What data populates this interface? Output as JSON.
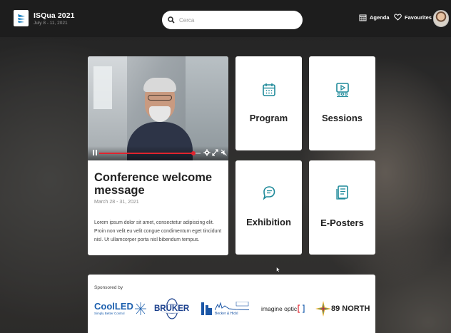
{
  "header": {
    "brand_title": "ISQua 2021",
    "brand_dates": "July 8 - 11, 2021",
    "search_placeholder": "Cerca",
    "agenda_label": "Agenda",
    "favourites_label": "Favourites"
  },
  "video_card": {
    "title": "Conference welcome message",
    "date": "March 28 - 31, 2021",
    "description": "Lorem ipsum dolor sit amet, consectetur adipiscing elit. Proin non velit eu velit congue condimentum eget tincidunt nisl. Ut ullamcorper porta nisl bibendum tempus.",
    "progress": 0.93
  },
  "tiles": [
    {
      "label": "Program",
      "icon": "calendar-icon"
    },
    {
      "label": "Sessions",
      "icon": "video-group-icon"
    },
    {
      "label": "Exhibition",
      "icon": "chat-bubble-icon"
    },
    {
      "label": "E-Posters",
      "icon": "document-icon"
    }
  ],
  "sponsors": {
    "heading": "Sponsored by",
    "logos": [
      {
        "name": "CoolLED",
        "tagline": "Simply Better Control"
      },
      {
        "name": "BRUKER"
      },
      {
        "name": "Becker & Hickl"
      },
      {
        "name": "imagine optic"
      },
      {
        "name": "89 NORTH"
      }
    ]
  },
  "colors": {
    "topbar": "#1d1d1d",
    "accent_red": "#e0242e",
    "coolled_blue": "#1c5fae",
    "bruker_blue": "#1a3f8c",
    "bh_blue": "#1b56a6"
  }
}
